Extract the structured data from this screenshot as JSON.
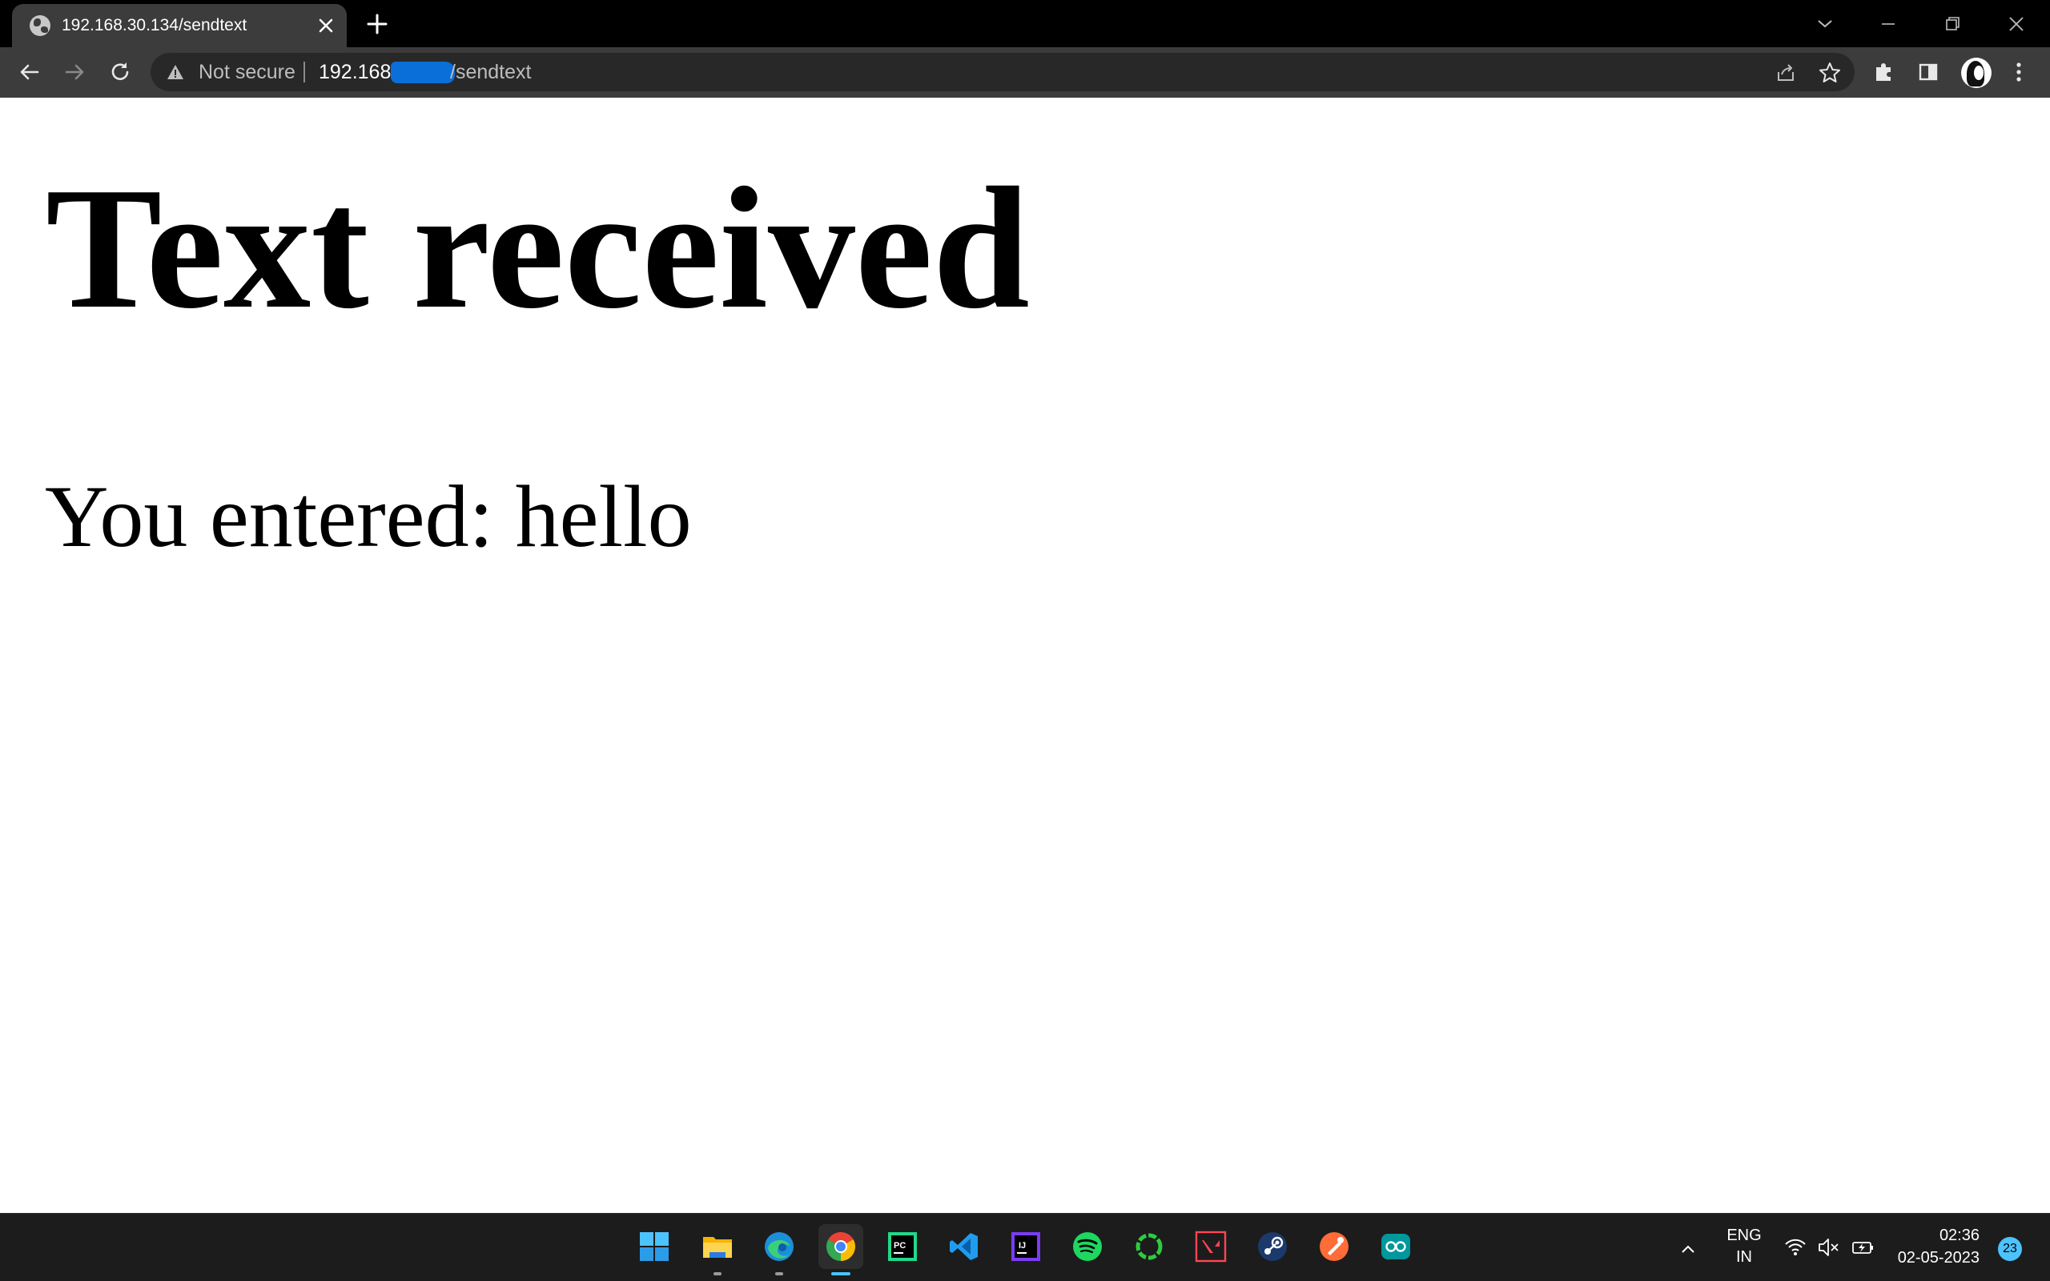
{
  "browser": {
    "tab": {
      "title": "192.168.30.134/sendtext",
      "favicon": "globe-icon"
    },
    "address_bar": {
      "security_label": "Not secure",
      "url_host_visible": "192.168.",
      "url_path": "/sendtext",
      "redacted_color": "#0a6fd8"
    },
    "toolbar_icons": [
      "back-arrow-icon",
      "forward-arrow-icon",
      "reload-icon",
      "share-icon",
      "star-icon",
      "puzzle-icon",
      "side-panel-icon",
      "profile-avatar",
      "kebab-menu-icon"
    ],
    "window_controls": [
      "tab-search-chevron-icon",
      "minimize-icon",
      "restore-icon",
      "close-icon"
    ]
  },
  "page": {
    "heading": "Text received",
    "entered_line": "You entered: hello"
  },
  "taskbar": {
    "apps": [
      "windows-start",
      "file-explorer",
      "edge",
      "chrome",
      "pycharm",
      "vscode",
      "intellij",
      "spotify",
      "razer-cortex",
      "valorant",
      "steam",
      "postman",
      "arduino"
    ],
    "active_app": "chrome",
    "language": {
      "line1": "ENG",
      "line2": "IN"
    },
    "clock": {
      "time": "02:36",
      "date": "02-05-2023"
    },
    "notification_count": "23"
  },
  "colors": {
    "tabstrip": "#000000",
    "toolbar": "#3c3c3c",
    "omnibox": "#282828",
    "taskbar": "#1c1c1c",
    "accent": "#4cc2ff"
  }
}
